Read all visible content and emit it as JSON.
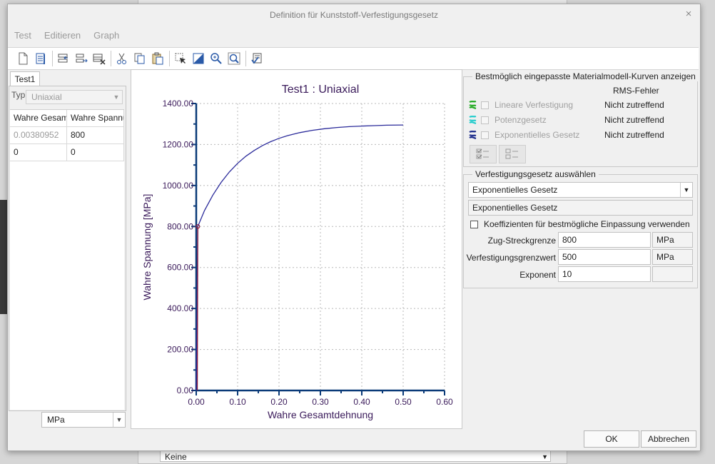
{
  "background": {
    "combo_value": "Keine"
  },
  "dialog": {
    "title": "Definition für Kunststoff-Verfestigungsgesetz",
    "close_glyph": "×"
  },
  "menu": [
    {
      "label": "Test"
    },
    {
      "label": "Editieren"
    },
    {
      "label": "Graph"
    }
  ],
  "toolbar": {
    "icons": [
      "new-icon",
      "table-icon",
      "insert-row-above-icon",
      "insert-row-below-icon",
      "delete-row-icon",
      "cut-icon",
      "copy-icon",
      "paste-icon",
      "select-icon",
      "fill-icon",
      "zoom-in-icon",
      "zoom-fit-icon",
      "check-icon"
    ]
  },
  "left": {
    "tab": "Test1",
    "typ_label": "Typ",
    "typ_value": "Uniaxial",
    "columns": [
      "Wahre Gesamtdehnung",
      "Wahre Spannung"
    ],
    "rows": [
      {
        "strain": "0.00380952",
        "stress": "800"
      },
      {
        "strain": "0",
        "stress": "0"
      }
    ],
    "unit": "MPa"
  },
  "chart_data": {
    "type": "line",
    "title": "Test1 : Uniaxial",
    "xlabel": "Wahre Gesamtdehnung",
    "ylabel": "Wahre Spannung [MPa]",
    "xlim": [
      0,
      0.6
    ],
    "ylim": [
      0,
      1400
    ],
    "xticks": [
      "0.00",
      "0.10",
      "0.20",
      "0.30",
      "0.40",
      "0.50",
      "0.60"
    ],
    "yticks": [
      "0.00",
      "200.00",
      "400.00",
      "600.00",
      "800.00",
      "1000.00",
      "1200.00",
      "1400.00"
    ],
    "grid": true,
    "series": [
      {
        "points": [
          [
            0,
            0
          ],
          [
            0.00380952,
            800
          ],
          [
            0.02,
            878
          ],
          [
            0.04,
            953
          ],
          [
            0.06,
            1015
          ],
          [
            0.08,
            1066
          ],
          [
            0.1,
            1108
          ],
          [
            0.12,
            1143
          ],
          [
            0.14,
            1171
          ],
          [
            0.16,
            1195
          ],
          [
            0.18,
            1214
          ],
          [
            0.2,
            1230
          ],
          [
            0.22,
            1243
          ],
          [
            0.25,
            1258
          ],
          [
            0.28,
            1269
          ],
          [
            0.31,
            1277
          ],
          [
            0.34,
            1283
          ],
          [
            0.37,
            1287
          ],
          [
            0.4,
            1290
          ],
          [
            0.43,
            1292
          ],
          [
            0.46,
            1294
          ],
          [
            0.5,
            1295
          ]
        ],
        "color": "#2a2a9a"
      }
    ],
    "data_markers": [
      [
        0.00380952,
        800
      ]
    ],
    "colors": {
      "axis": "#0a3a78",
      "text": "#3a1a5a",
      "grid": "#b8b8b8",
      "marker": "#8b1a3a"
    }
  },
  "fit": {
    "title": "Bestmöglich eingepasste Materialmodell-Kurven anzeigen",
    "rms_header": "RMS-Fehler",
    "rows": [
      {
        "label": "Lineare Verfestigung",
        "rms": "Nicht zutreffend",
        "color": "#22aa22"
      },
      {
        "label": "Potenzgesetz",
        "rms": "Nicht zutreffend",
        "color": "#22cccc"
      },
      {
        "label": "Exponentielles Gesetz",
        "rms": "Nicht zutreffend",
        "color": "#1a2a8a"
      }
    ]
  },
  "law": {
    "title": "Verfestigungsgesetz auswählen",
    "selected": "Exponentielles Gesetz",
    "formula_text": "Exponentielles Gesetz",
    "coef_checkbox": "Koeffizienten für bestmögliche Einpassung verwenden",
    "params": [
      {
        "label": "Zug-Streckgrenze",
        "value": "800",
        "unit": "MPa"
      },
      {
        "label": "Verfestigungsgrenzwert",
        "value": "500",
        "unit": "MPa"
      },
      {
        "label": "Exponent",
        "value": "10",
        "unit": ""
      }
    ]
  },
  "buttons": {
    "ok": "OK",
    "cancel": "Abbrechen"
  }
}
